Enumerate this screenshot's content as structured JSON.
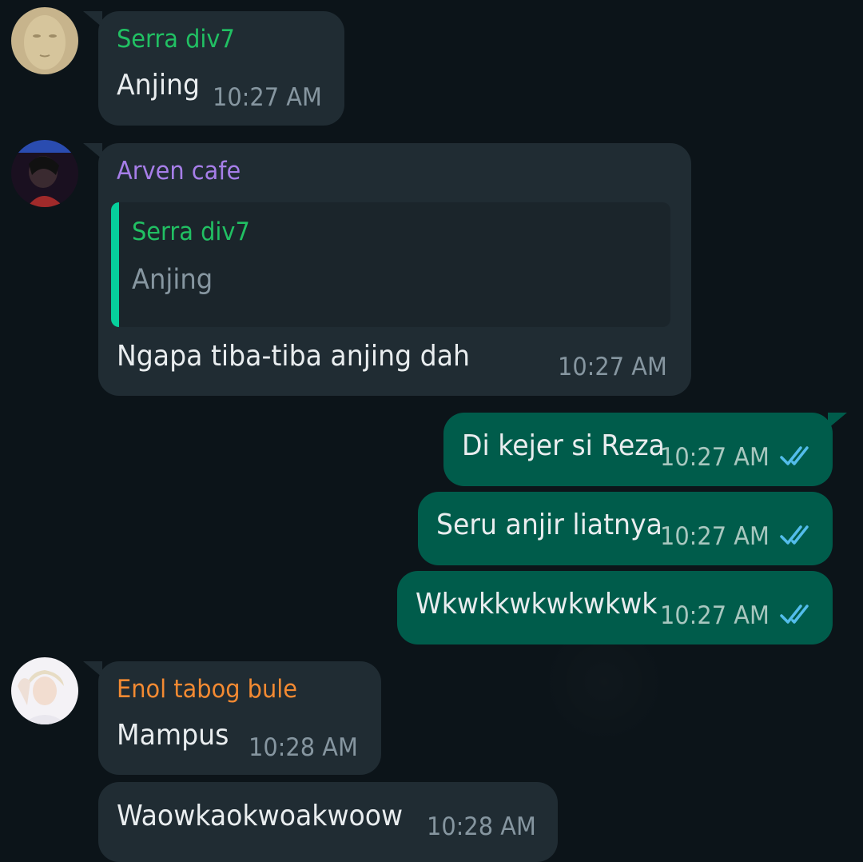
{
  "messages": [
    {
      "sender": "Serra div7",
      "text": "Anjing",
      "time": "10:27 AM"
    },
    {
      "sender": "Arven cafe",
      "quote_sender": "Serra div7",
      "quote_text": "Anjing",
      "text": "Ngapa tiba-tiba anjing dah",
      "time": "10:27 AM"
    },
    {
      "text": "Di kejer si Reza",
      "time": "10:27 AM",
      "status": "read"
    },
    {
      "text": "Seru anjir liatnya",
      "time": "10:27 AM",
      "status": "read"
    },
    {
      "text": "Wkwkkwkwkwkwk",
      "time": "10:27 AM",
      "status": "read"
    },
    {
      "sender": "Enol tabog bule",
      "text": "Mampus",
      "time": "10:28 AM"
    },
    {
      "text": "Waowkaokwoakwoow",
      "time": "10:28 AM"
    }
  ],
  "colors": {
    "serra": "#21c063",
    "arven": "#a67ee8",
    "enol": "#f38a32",
    "read_tick": "#53bdeb",
    "incoming_bubble": "#202c33",
    "outgoing_bubble": "#005c4b"
  },
  "icons": {
    "read_status": "double-check-icon"
  }
}
